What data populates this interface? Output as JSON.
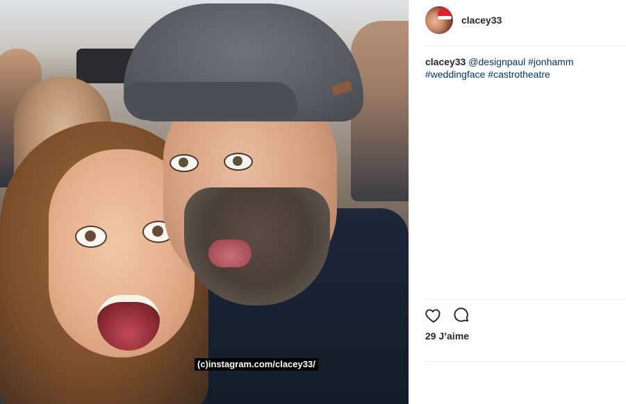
{
  "post": {
    "watermark_text": "(c)instagram.com/clacey33/"
  },
  "header": {
    "username": "clacey33"
  },
  "caption": {
    "username": "clacey33",
    "mention": "@designpaul",
    "hashtags": [
      "#jonhamm",
      "#weddingface",
      "#castrotheatre"
    ]
  },
  "actions": {
    "like_icon": "heart-icon",
    "comment_icon": "comment-icon"
  },
  "likes": {
    "text": "29 J’aime"
  },
  "colors": {
    "link": "#003569",
    "text": "#262626",
    "divider": "#efefef"
  }
}
